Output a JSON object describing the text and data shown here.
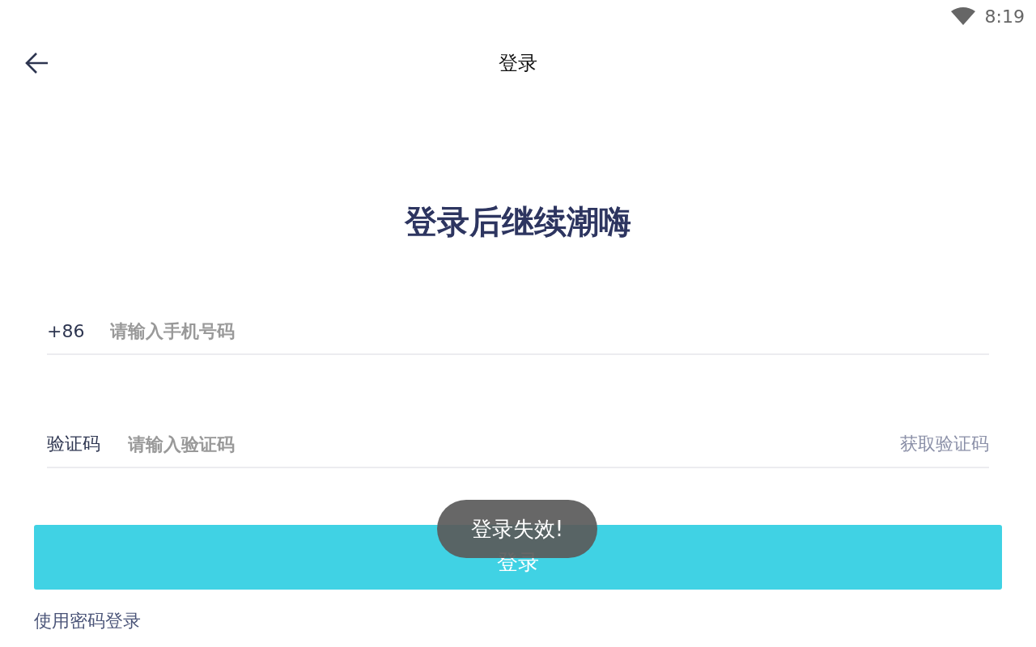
{
  "status_bar": {
    "time": "8:19"
  },
  "header": {
    "title": "登录"
  },
  "heading": "登录后继续潮嗨",
  "phone_field": {
    "prefix": "+86",
    "placeholder": "请输入手机号码"
  },
  "code_field": {
    "label": "验证码",
    "placeholder": "请输入验证码",
    "action": "获取验证码"
  },
  "login_button": "登录",
  "toast": "登录失效!",
  "password_login_link": "使用密码登录"
}
